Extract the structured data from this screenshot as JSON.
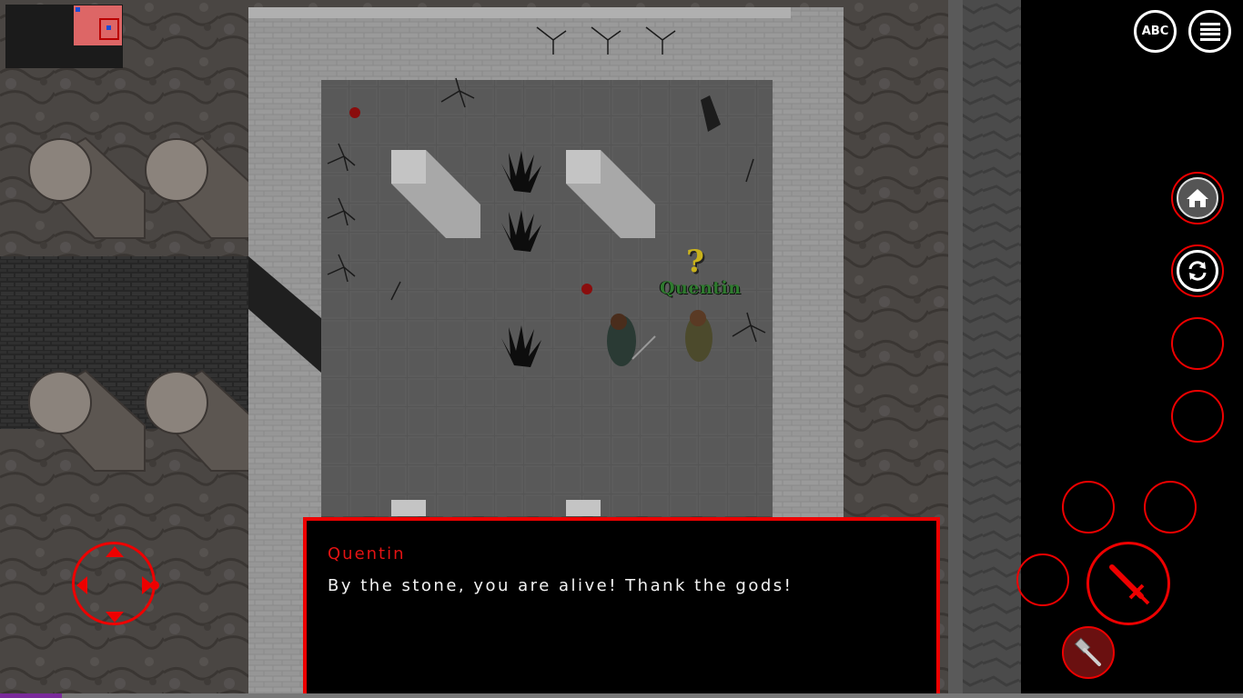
{
  "toolbar": {
    "keyboard_label": "ABC",
    "keyboard_icon": "keyboard-toggle-icon",
    "menu_icon": "hamburger-menu-icon"
  },
  "actions": {
    "home_icon": "home-icon",
    "refresh_icon": "refresh-icon",
    "attack_icon": "sword-icon",
    "tool_icon": "hammer-icon"
  },
  "npc": {
    "name": "Quentin",
    "quest_marker": "?"
  },
  "dialog": {
    "speaker": "Quentin",
    "text": "By the stone, you are alive! Thank the gods!"
  },
  "status": {
    "experience_fraction": 0.05
  },
  "colors": {
    "hud_red": "#e00000",
    "npc_name": "#2f7a2f",
    "quest_marker": "#c9b21c",
    "experience": "#7a2a9a"
  }
}
